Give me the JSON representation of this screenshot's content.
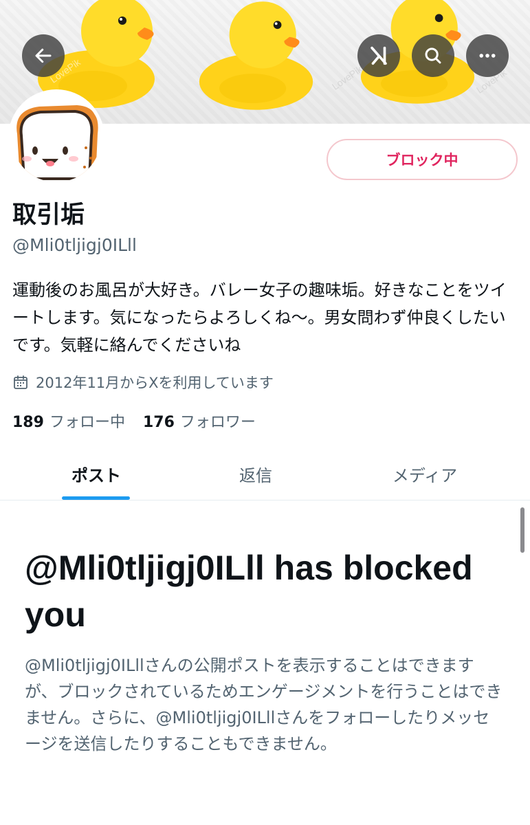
{
  "header": {
    "back_icon": "arrow-left-icon",
    "grok_icon": "grok-icon",
    "search_icon": "search-icon",
    "more_icon": "more-icon"
  },
  "banner": {
    "watermark": "LovePik"
  },
  "profile": {
    "display_name": "取引垢",
    "handle": "@Mli0tljigj0ILll",
    "bio": "運動後のお風呂が大好き。バレー女子の趣味垢。好きなことをツイートします。気になったらよろしくね〜。男女問わず仲良くしたいです。気軽に絡んでくださいね",
    "joined": "2012年11月からXを利用しています",
    "following_count": "189",
    "following_label": "フォロー中",
    "followers_count": "176",
    "followers_label": "フォロワー",
    "block_button_label": "ブロック中",
    "block_color": "#e0245e"
  },
  "tabs": [
    {
      "label": "ポスト",
      "active": true
    },
    {
      "label": "返信",
      "active": false
    },
    {
      "label": "メディア",
      "active": false
    }
  ],
  "blocked": {
    "title": "@Mli0tljigj0ILll has blocked you",
    "description": "@Mli0tljigj0ILllさんの公開ポストを表示することはできますが、ブロックされているためエンゲージメントを行うことはできません。さらに、@Mli0tljigj0ILllさんをフォローしたりメッセージを送信したりすることもできません。"
  },
  "colors": {
    "accent": "#1d9bf0",
    "text_primary": "#0f1419",
    "text_secondary": "#536471"
  }
}
